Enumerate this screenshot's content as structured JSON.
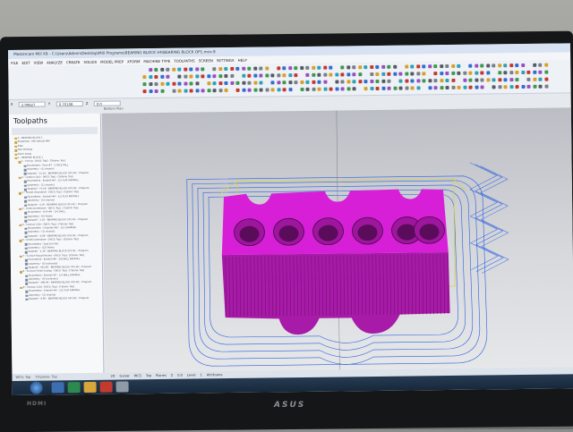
{
  "window": {
    "title": "Mastercam Mill X9 - C:\\Users\\Admin\\Desktop\\Mill Programs\\BEARING BLOCK V4\\BEARING BLOCK OP1.mcx-9"
  },
  "menu": [
    "FILE",
    "EDIT",
    "VIEW",
    "ANALYZE",
    "CREATE",
    "SOLIDS",
    "MODEL PREP",
    "XFORM",
    "MACHINE TYPE",
    "TOOLPATHS",
    "SCREEN",
    "SETTINGS",
    "HELP"
  ],
  "coords": {
    "x_label": "X",
    "x_value": "2.99627",
    "y_label": "Y",
    "y_value": "0.70108",
    "z_label": "Z",
    "z_value": "0.0"
  },
  "toolpaths_panel": {
    "title": "Toolpaths",
    "tree": [
      "1 - BEARING BLOCK 1",
      "Properties - Mill Default MM",
      "Files",
      "Tool settings",
      "Stock setup",
      "1 - BEARING BLOCK 1",
      "1 - Facing - [WCS: Top] - [Tplane: Top]",
      "Parameters - Face #7 - 2 FACE MILL",
      "Geometry - (1) chain(s)",
      "Toolpath - 31.1K - BEARING BLOCK OP1.NC - Program",
      "2 - Contour (2D) - [WCS: Top] - [Tplane: Top]",
      "Parameters - Endmill #4 - 1/2 FLAT ENDMILL",
      "Geometry - (1) chain(s)",
      "Toolpath - 74.2K - BEARING BLOCK OP1.NC - Program",
      "3 - Pocket (Standard) - [WCS: Top] - [Tplane: Top]",
      "Parameters - Endmill #4 - 1/2 FLAT ENDMILL",
      "Geometry - (5) chain(s)",
      "Toolpath - 4.1K - BEARING BLOCK OP1.NC - Program",
      "4 - Drill/Counterbore - [WCS: Top] - [Tplane: Top]",
      "Parameters - Drill #9 - 1/4 DRILL",
      "Geometry - (6) Points",
      "Toolpath - 3.1K - BEARING BLOCK OP1.NC - Program",
      "5 - Contour (2D) - [WCS: Top] - [Tplane: Top]",
      "Parameters - Chamfer Mill - 1/2 CHAMFER",
      "Geometry - (1) chain(s)",
      "Toolpath - 6.9K - BEARING BLOCK OP1.NC - Program",
      "6 - Drill/Counterbore - [WCS: Top] - [Tplane: Top]",
      "Parameters - Spot Drill #2",
      "Geometry - (12) Points",
      "Toolpath - 2.1K - BEARING BLOCK OP1.NC - Program",
      "7 - Surface Rough Pocket - [WCS: Top] - [Tplane: Top]",
      "Parameters - Endmill #6 - 3/8 BALL ENDMILL",
      "Geometry - (5) surface(s)",
      "Toolpath - 402.5K - BEARING BLOCK OP1.NC - Program",
      "8 - Surface Finish Scallop - [WCS: Top] - [Tplane: Top]",
      "Parameters - Endmill #7 - 1/4 BALL ENDMILL",
      "Geometry - (5) surface(s)",
      "Toolpath - 388.0K - BEARING BLOCK OP1.NC - Program",
      "9 - Contour (2D) - [WCS: Top] - [Tplane: Top]",
      "Parameters - Endmill #4 - 1/2 FLAT ENDMILL",
      "Geometry - (2) chain(s)",
      "Toolpath - 9.5K - BEARING BLOCK OP1.NC - Program"
    ],
    "tabs": [
      "Toolpaths",
      "Solids"
    ]
  },
  "viewport": {
    "label": "Bottom Plan",
    "part_color": "#d81fd8",
    "toolpath_color": "#2a5fe0",
    "stock_color": "#d8d03a"
  },
  "status": {
    "items": [
      "2D",
      "Gview",
      "WCS",
      "Top",
      "Planes",
      "Z",
      "0.0",
      "Level",
      "1",
      "Attributes"
    ],
    "bottom_tabs": [
      "WCS: Top",
      "T/Cplane: Top"
    ]
  },
  "monitor": {
    "port_label": "HDMI",
    "brand": "ASUS"
  },
  "colors": {
    "bezel": "#151617",
    "taskbar": "#1d3046",
    "ui_bg": "#eef1f5"
  }
}
